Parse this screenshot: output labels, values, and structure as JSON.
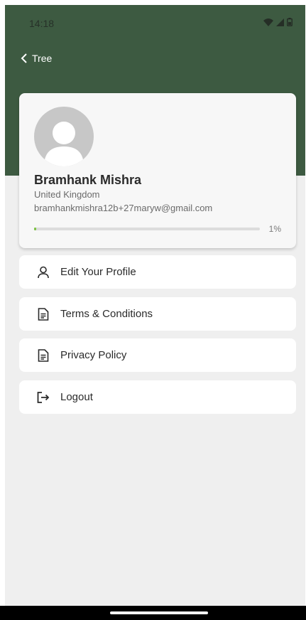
{
  "status_bar": {
    "time": "14:18"
  },
  "header": {
    "back_label": "Tree"
  },
  "profile": {
    "name": "Bramhank Mishra",
    "country": "United Kingdom",
    "email": "bramhankmishra12b+27maryw@gmail.com",
    "completion_fraction": 0.01,
    "completion_label": "1%"
  },
  "menu": {
    "items": [
      {
        "label": "Edit Your Profile",
        "icon": "person-icon"
      },
      {
        "label": "Terms & Conditions",
        "icon": "document-icon"
      },
      {
        "label": "Privacy Policy",
        "icon": "document-icon"
      },
      {
        "label": "Logout",
        "icon": "logout-icon"
      }
    ]
  },
  "colors": {
    "header_bg": "#3d5a41",
    "page_bg": "#efefef",
    "progress_fill": "#7bc142"
  }
}
